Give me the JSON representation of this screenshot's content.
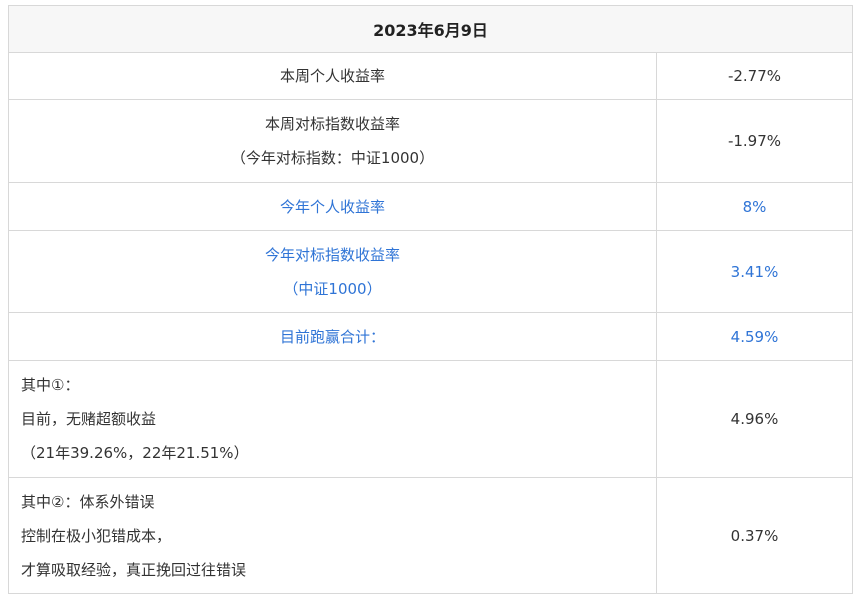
{
  "title": "2023年6月9日",
  "rows": [
    {
      "label_lines": [
        "本周个人收益率"
      ],
      "value": "-2.77%",
      "highlight": false
    },
    {
      "label_lines": [
        "本周对标指数收益率",
        "（今年对标指数：中证1000）"
      ],
      "value": "-1.97%",
      "highlight": false
    },
    {
      "label_lines": [
        "今年个人收益率"
      ],
      "value": "8%",
      "highlight": true
    },
    {
      "label_lines": [
        "今年对标指数收益率",
        "（中证1000）"
      ],
      "value": "3.41%",
      "highlight": true
    },
    {
      "label_lines": [
        "目前跑赢合计："
      ],
      "value": "4.59%",
      "highlight": true
    },
    {
      "label_lines": [
        "其中①：",
        "目前，无赌超额收益",
        "（21年39.26%，22年21.51%）"
      ],
      "value": "4.96%",
      "highlight": false
    },
    {
      "label_lines": [
        "其中②：体系外错误",
        "控制在极小犯错成本，",
        "才算吸取经验，真正挽回过往错误"
      ],
      "value": "0.37%",
      "highlight": false
    }
  ],
  "colors": {
    "highlight_text": "#2f74d6",
    "normal_text": "#333333",
    "border": "#d8d8d8",
    "header_bg": "#f7f7f7"
  }
}
